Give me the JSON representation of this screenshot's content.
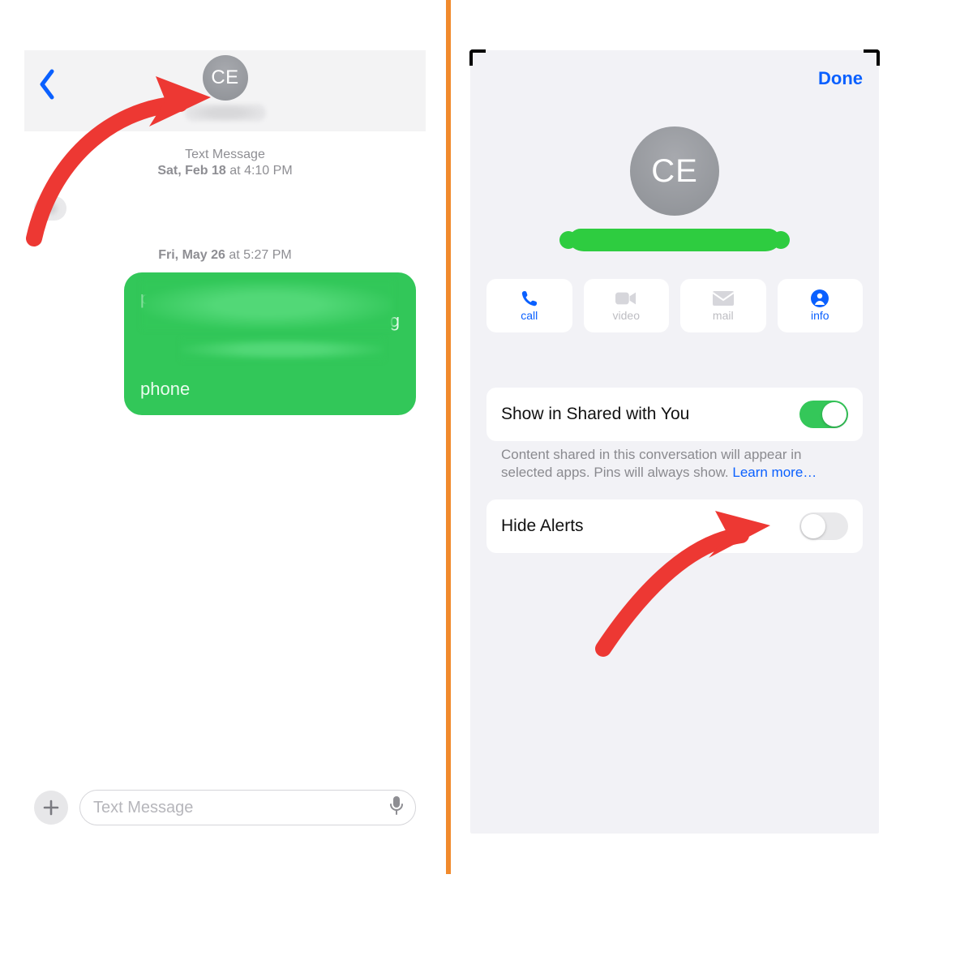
{
  "left": {
    "avatar_initials": "CE",
    "sys_kind": "Text Message",
    "date1_prefix": "Sat, Feb 18",
    "date1_at": " at ",
    "date1_time": "4:10 PM",
    "date2_prefix": "Fri, May 26",
    "date2_at": " at ",
    "date2_time": "5:27 PM",
    "incoming_peek": "",
    "outgoing_l1": "p",
    "outgoing_l2_tail": "g",
    "outgoing_l3": "phone",
    "input_placeholder": "Text Message"
  },
  "right": {
    "done": "Done",
    "avatar_initials": "CE",
    "actions": {
      "call": "call",
      "video": "video",
      "mail": "mail",
      "info": "info"
    },
    "shared_label": "Show in Shared with You",
    "shared_on": true,
    "shared_note_a": "Content shared in this conversation will appear in selected apps. Pins will always show. ",
    "shared_note_link": "Learn more…",
    "hide_label": "Hide Alerts",
    "hide_on": false
  }
}
